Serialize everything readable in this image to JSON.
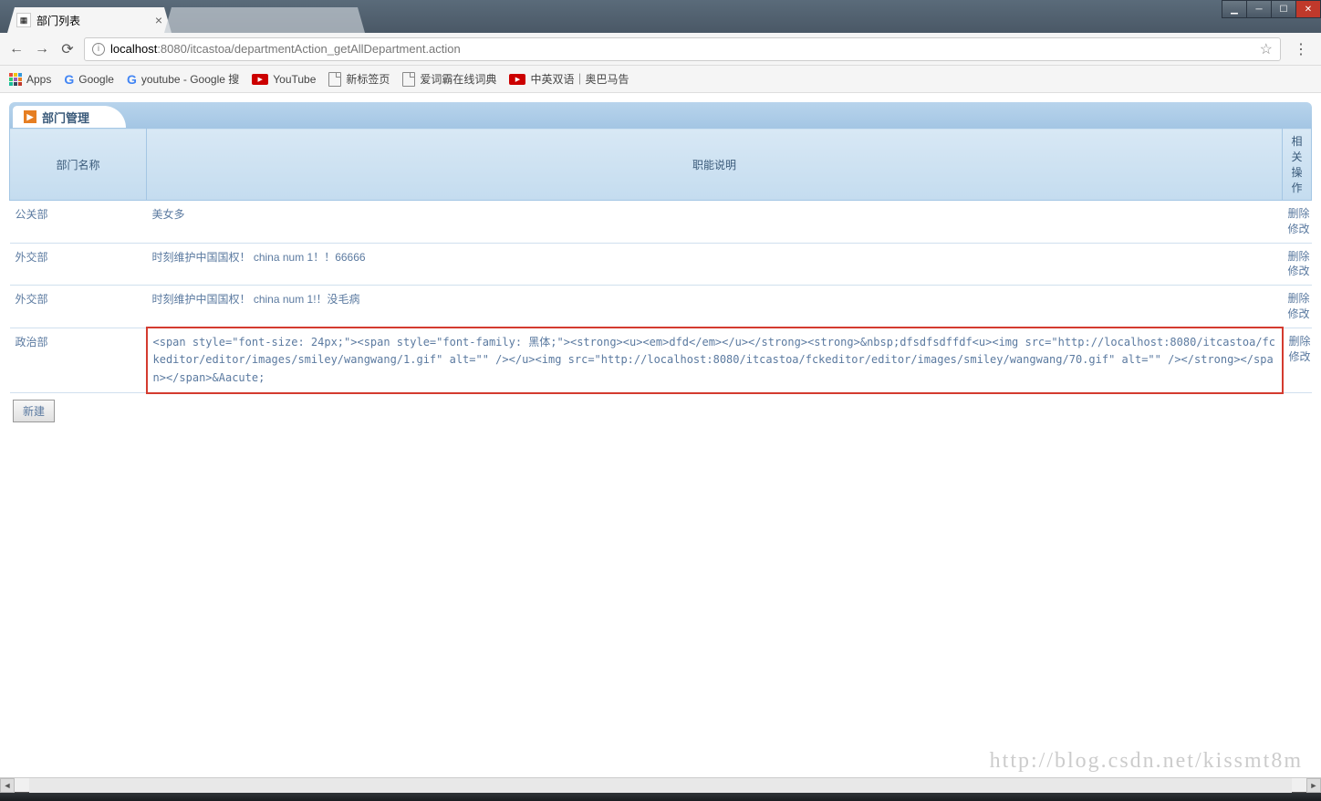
{
  "browser": {
    "tabs": [
      {
        "title": "部门列表",
        "active": true
      },
      {
        "title": "",
        "active": false
      }
    ],
    "url_host": "localhost",
    "url_port": ":8080",
    "url_path": "/itcastoa/departmentAction_getAllDepartment.action",
    "bookmarks": {
      "apps": "Apps",
      "google": "Google",
      "youtube_google": "youtube - Google 搜",
      "youtube": "YouTube",
      "new_tab": "新标签页",
      "dict": "爱词霸在线词典",
      "cn_en": "中英双语｜奥巴马告"
    }
  },
  "page": {
    "panel_title": "部门管理",
    "columns": {
      "name": "部门名称",
      "desc": "职能说明",
      "ops": "相关操作"
    },
    "rows": [
      {
        "name": "公关部",
        "desc": "美女多",
        "op_del": "删除",
        "op_edit": "修改"
      },
      {
        "name": "外交部",
        "desc": "时刻维护中国国权！ china num 1！！66666",
        "op_del": "删除",
        "op_edit": "修改"
      },
      {
        "name": "外交部",
        "desc": "时刻维护中国国权！ china num 1!！没毛病",
        "op_del": "删除",
        "op_edit": "修改"
      },
      {
        "name": "政治部",
        "desc": "<span style=\"font-size: 24px;\"><span style=\"font-family: 黑体;\"><strong><u><em>dfd</em></u></strong><strong>&nbsp;dfsdfsdffdf<u><img src=\"http://localhost:8080/itcastoa/fckeditor/editor/images/smiley/wangwang/1.gif\" alt=\"\" /></u><img src=\"http://localhost:8080/itcastoa/fckeditor/editor/images/smiley/wangwang/70.gif\" alt=\"\" /></strong></span></span>&Aacute;",
        "op_del": "删除",
        "op_edit": "修改",
        "highlight": true
      }
    ],
    "new_button": "新建",
    "watermark": "http://blog.csdn.net/kissmt8m"
  }
}
